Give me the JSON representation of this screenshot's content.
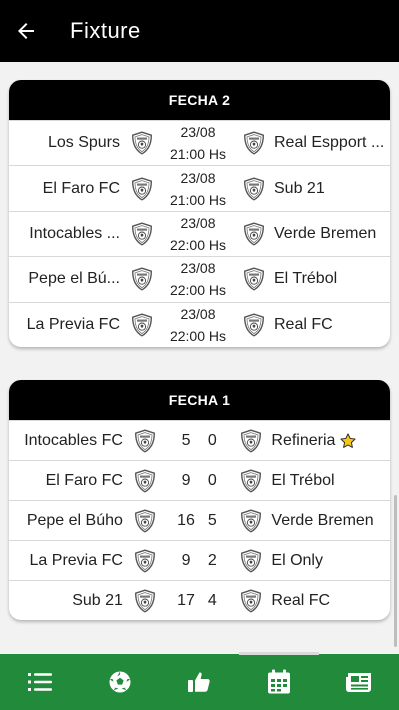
{
  "header": {
    "title": "Fixture"
  },
  "upcoming": {
    "title": "FECHA 2",
    "matches": [
      {
        "home": "Los Spurs",
        "date": "23/08",
        "time": "21:00 Hs",
        "away": "Real Espport ..."
      },
      {
        "home": "El Faro FC",
        "date": "23/08",
        "time": "21:00 Hs",
        "away": "Sub 21"
      },
      {
        "home": "Intocables ...",
        "date": "23/08",
        "time": "22:00 Hs",
        "away": "Verde Bremen"
      },
      {
        "home": "Pepe el Bú...",
        "date": "23/08",
        "time": "22:00 Hs",
        "away": "El Trébol"
      },
      {
        "home": "La Previa FC",
        "date": "23/08",
        "time": "22:00 Hs",
        "away": "Real FC"
      }
    ]
  },
  "results": {
    "title": "FECHA 1",
    "matches": [
      {
        "home": "Intocables FC",
        "home_score": "5",
        "away_score": "0",
        "away": "Refineria",
        "starred": true
      },
      {
        "home": "El Faro FC",
        "home_score": "9",
        "away_score": "0",
        "away": "El Trébol"
      },
      {
        "home": "Pepe el Búho",
        "home_score": "16",
        "away_score": "5",
        "away": "Verde Bremen"
      },
      {
        "home": "La Previa FC",
        "home_score": "9",
        "away_score": "2",
        "away": "El Only"
      },
      {
        "home": "Sub 21",
        "home_score": "17",
        "away_score": "4",
        "away": "Real FC"
      }
    ]
  },
  "bottom_nav": {
    "items": [
      {
        "icon": "list-icon"
      },
      {
        "icon": "soccer-ball-icon"
      },
      {
        "icon": "thumbs-up-icon"
      },
      {
        "icon": "calendar-icon",
        "active": true
      },
      {
        "icon": "newspaper-icon"
      }
    ]
  },
  "colors": {
    "nav_bg": "#228b3b",
    "header_bg": "#000000",
    "star": "#f5c518"
  }
}
